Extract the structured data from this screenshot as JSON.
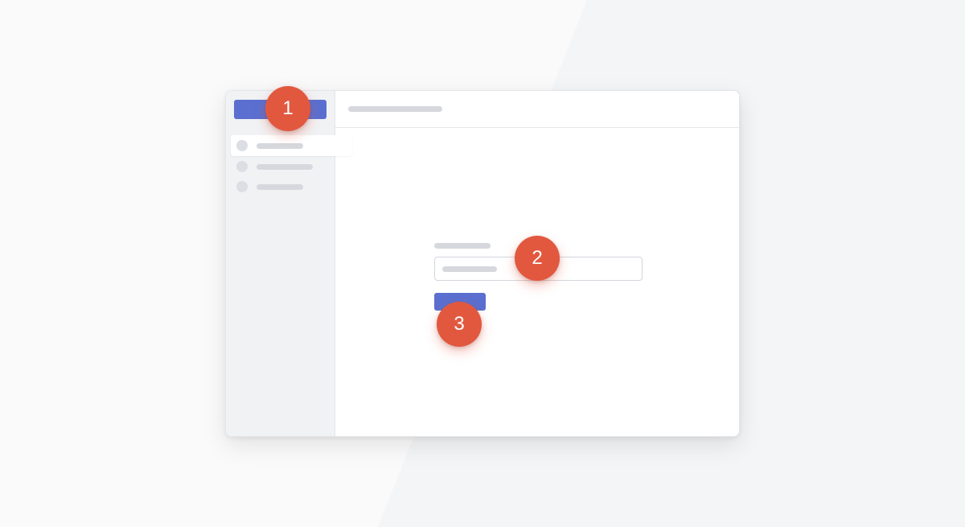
{
  "annotations": {
    "step_1": "1",
    "step_2": "2",
    "step_3": "3"
  },
  "colors": {
    "accent": "#5a6fd0",
    "badge": "#e2583f",
    "sidebar_bg": "#f1f2f4"
  },
  "sidebar": {
    "items": [
      {
        "icon": "circle-icon",
        "active": true
      },
      {
        "icon": "circle-icon",
        "active": false
      },
      {
        "icon": "circle-icon",
        "active": false
      }
    ]
  }
}
